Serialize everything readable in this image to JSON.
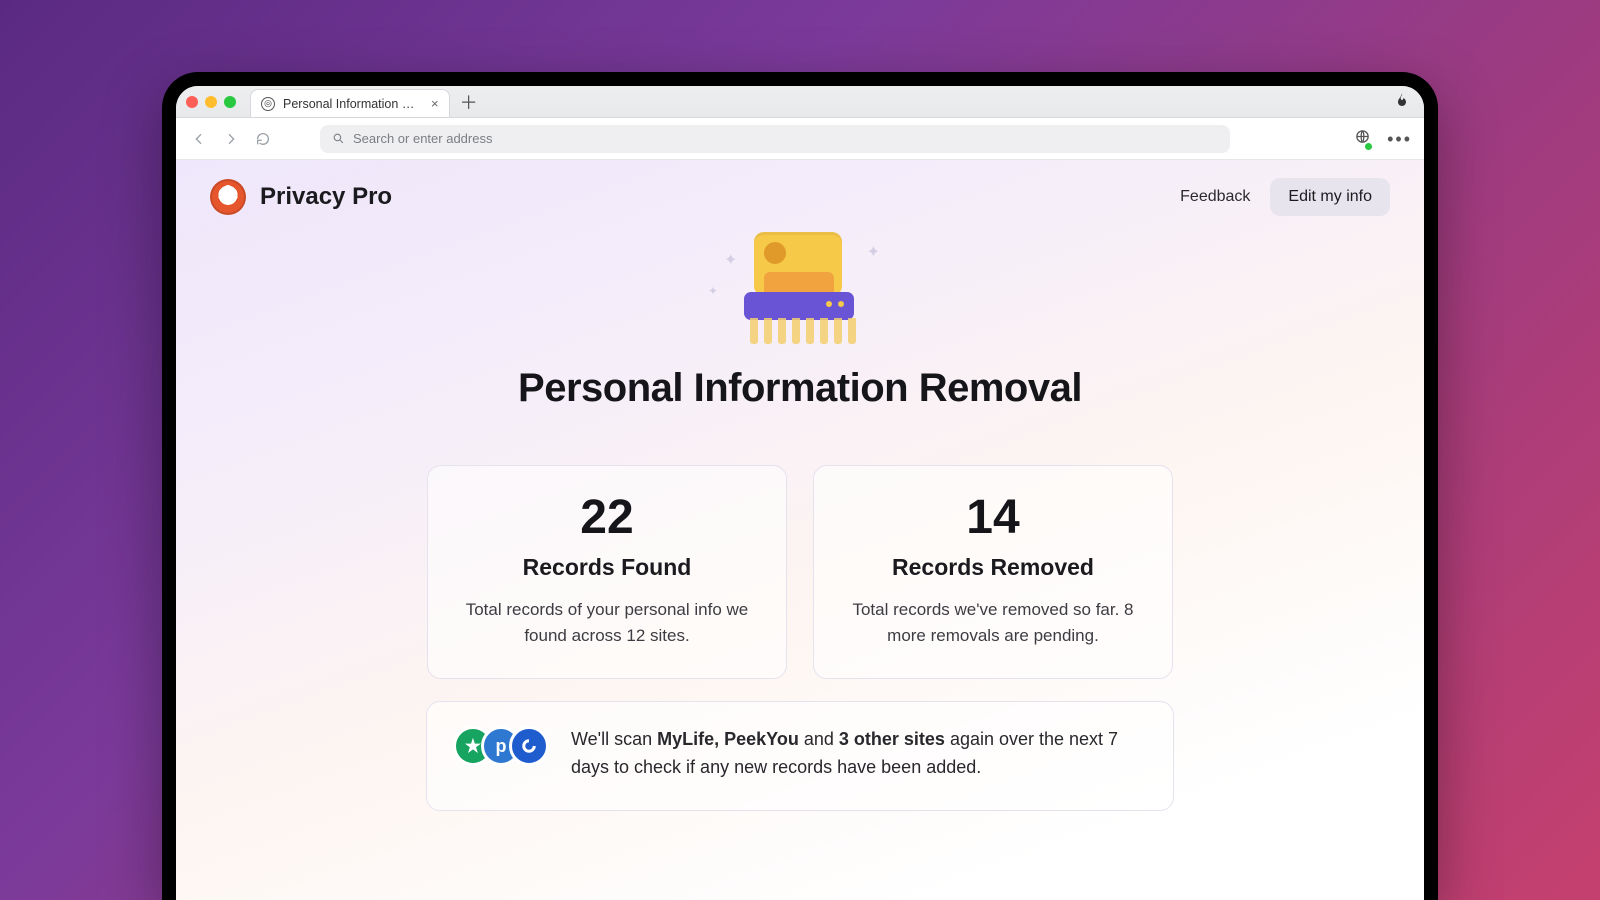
{
  "browser": {
    "tab_title": "Personal Information Removal",
    "address_placeholder": "Search or enter address"
  },
  "header": {
    "brand": "Privacy Pro",
    "feedback_label": "Feedback",
    "edit_label": "Edit my info"
  },
  "hero": {
    "title": "Personal Information Removal"
  },
  "cards": {
    "found": {
      "value": "22",
      "label": "Records Found",
      "desc": "Total records of your personal info we found across 12 sites."
    },
    "removed": {
      "value": "14",
      "label": "Records Removed",
      "desc": "Total records we've removed so far. 8 more removals are pending."
    }
  },
  "scan": {
    "prefix": "We'll scan ",
    "bold_sites": "MyLife, PeekYou",
    "mid": " and ",
    "bold_other": "3 other sites",
    "suffix": " again over the next 7 days to check if any new records have been added."
  }
}
